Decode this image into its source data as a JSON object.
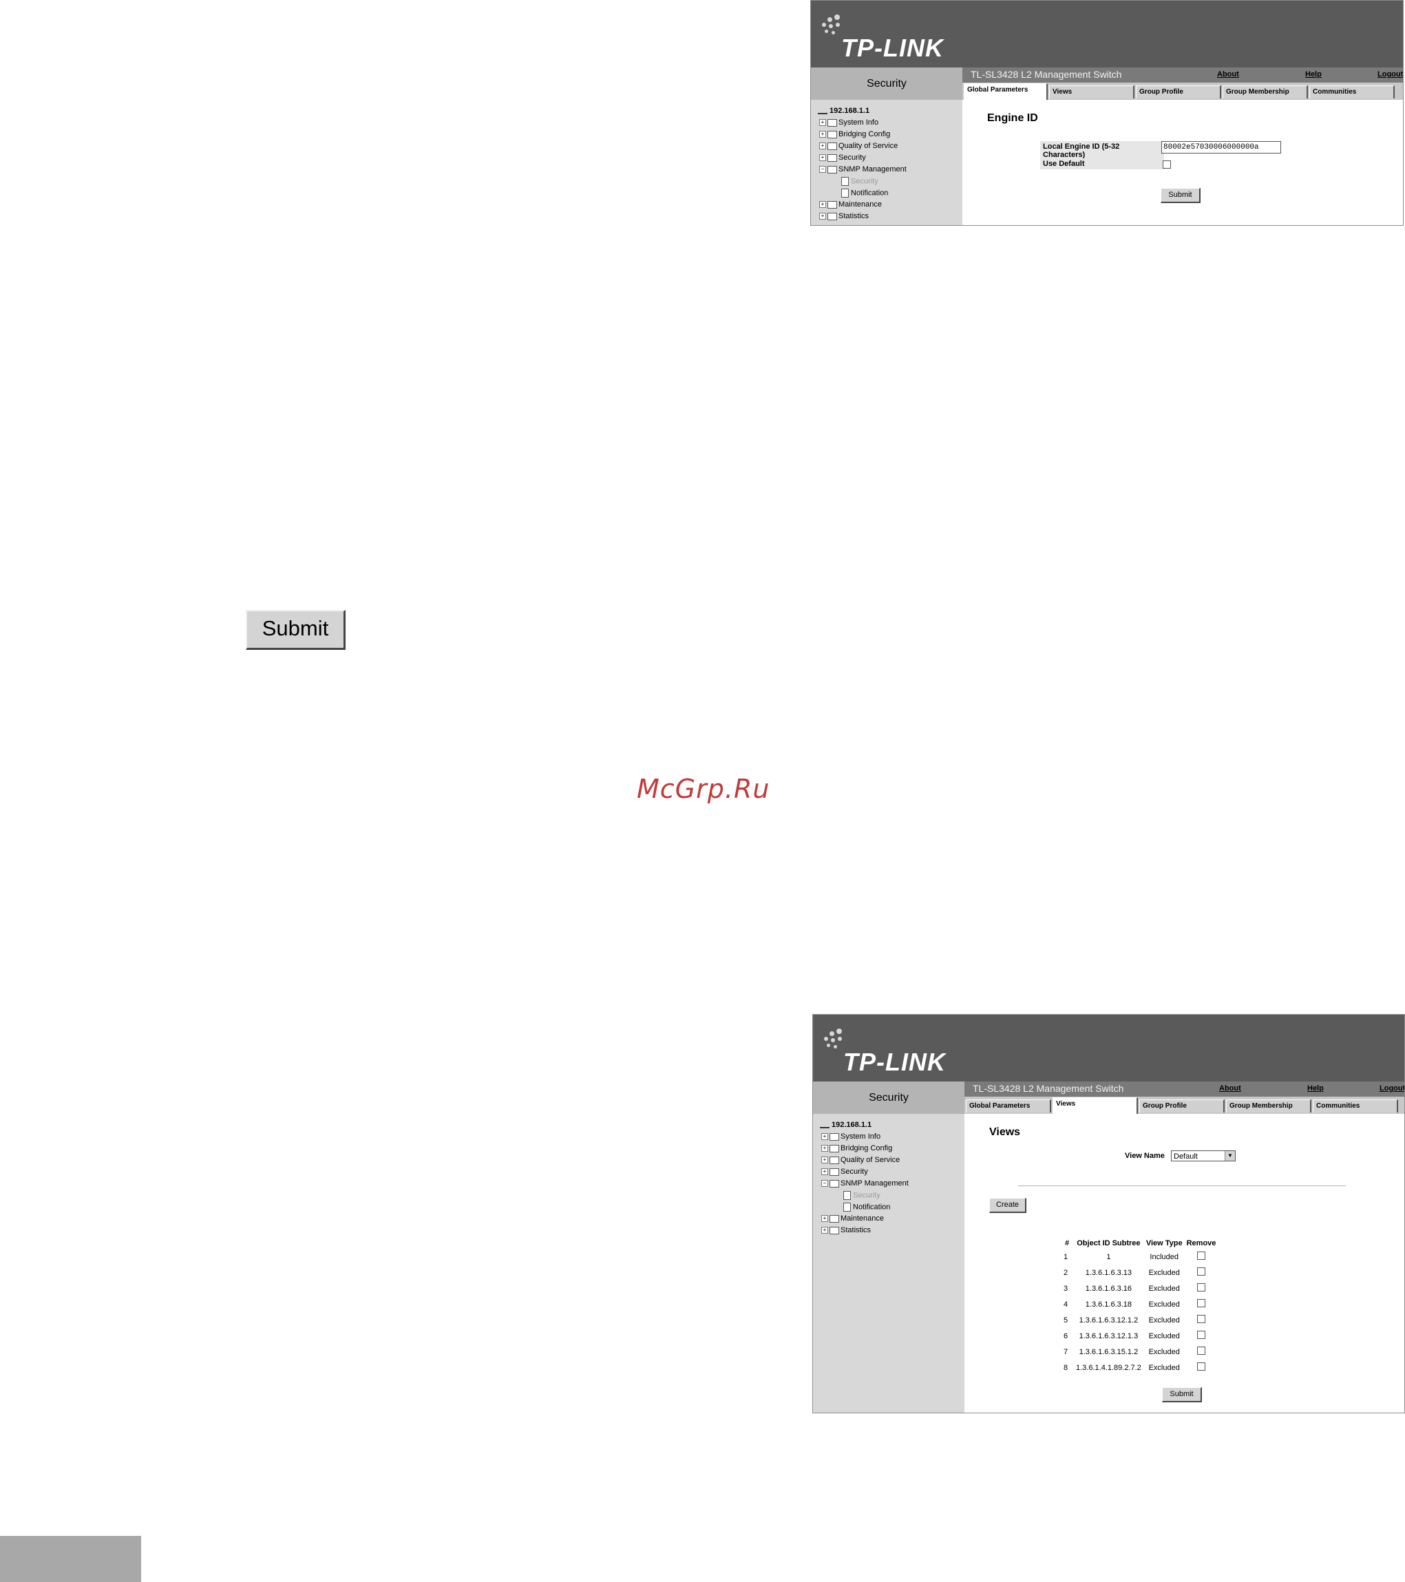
{
  "brand": {
    "name": "TP-LINK",
    "color_banner": "#5a5a5a"
  },
  "screens": {
    "top": {
      "side_title": "Security",
      "switch_title": "TL-SL3428 L2 Management Switch",
      "links": {
        "about": "About",
        "help": "Help",
        "logout": "Logout"
      },
      "tabs": [
        "Global Parameters",
        "Views",
        "Group Profile",
        "Group Membership",
        "Communities"
      ],
      "tree": {
        "root": "192.168.1.1",
        "items": [
          "System Info",
          "Bridging Config",
          "Quality of Service",
          "Security",
          "SNMP Management"
        ],
        "subitems": [
          "Security",
          "Notification"
        ],
        "after": [
          "Maintenance",
          "Statistics"
        ]
      },
      "page_title": "Engine ID",
      "form": {
        "engine_label": "Local Engine ID (5-32 Characters)",
        "engine_value": "80002e57030006000000a",
        "default_label": "Use Default",
        "submit": "Submit"
      }
    },
    "bottom": {
      "side_title": "Security",
      "switch_title": "TL-SL3428 L2 Management Switch",
      "links": {
        "about": "About",
        "help": "Help",
        "logout": "Logout"
      },
      "tabs": [
        "Global Parameters",
        "Views",
        "Group Profile",
        "Group Membership",
        "Communities"
      ],
      "tree": {
        "root": "192.168.1.1",
        "items": [
          "System Info",
          "Bridging Config",
          "Quality of Service",
          "Security",
          "SNMP Management"
        ],
        "subitems": [
          "Security",
          "Notification"
        ],
        "after": [
          "Maintenance",
          "Statistics"
        ]
      },
      "page_title": "Views",
      "view_name_label": "View Name",
      "view_name_value": "Default",
      "create": "Create",
      "table": {
        "headers": [
          "#",
          "Object ID Subtree",
          "View Type",
          "Remove"
        ],
        "rows": [
          [
            "1",
            "1",
            "Included"
          ],
          [
            "2",
            "1.3.6.1.6.3.13",
            "Excluded"
          ],
          [
            "3",
            "1.3.6.1.6.3.16",
            "Excluded"
          ],
          [
            "4",
            "1.3.6.1.6.3.18",
            "Excluded"
          ],
          [
            "5",
            "1.3.6.1.6.3.12.1.2",
            "Excluded"
          ],
          [
            "6",
            "1.3.6.1.6.3.12.1.3",
            "Excluded"
          ],
          [
            "7",
            "1.3.6.1.6.3.15.1.2",
            "Excluded"
          ],
          [
            "8",
            "1.3.6.1.4.1.89.2.7.2",
            "Excluded"
          ]
        ]
      },
      "submit": "Submit"
    }
  },
  "standalone_submit": "Submit",
  "watermark": "McGrp.Ru"
}
